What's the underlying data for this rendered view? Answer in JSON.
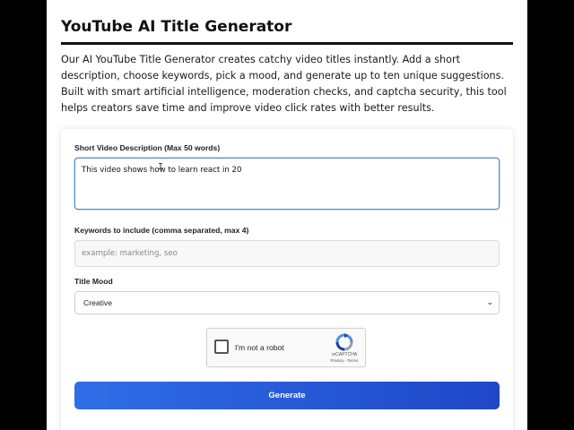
{
  "page": {
    "title": "YouTube AI Title Generator",
    "intro": "Our AI YouTube Title Generator creates catchy video titles instantly. Add a short description, choose keywords, pick a mood, and generate up to ten unique suggestions. Built with smart artificial intelligence, moderation checks, and captcha security, this tool helps creators save time and improve video click rates with better results."
  },
  "form": {
    "description_label": "Short Video Description (Max 50 words)",
    "description_value": "This video shows how to learn react in 20",
    "keywords_label": "Keywords to include (comma separated, max 4)",
    "keywords_value": "",
    "keywords_placeholder": "example: marketing, seo",
    "mood_label": "Title Mood",
    "mood_value": "Creative",
    "generate_label": "Generate"
  },
  "captcha": {
    "label": "I'm not a robot",
    "brand": "reCAPTCHA",
    "legal": "Privacy - Terms"
  },
  "colors": {
    "button_start": "#2f6ee6",
    "button_end": "#1f47c7",
    "focus_border": "#5a86d6"
  }
}
